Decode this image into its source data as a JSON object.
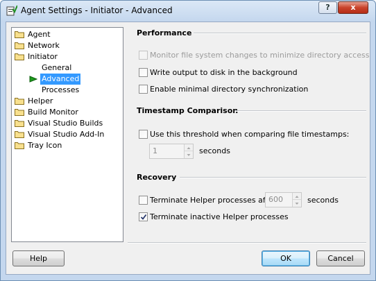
{
  "window": {
    "title": "Agent Settings - Initiator - Advanced",
    "help_glyph": "?",
    "close_glyph": "x"
  },
  "tree": {
    "items": [
      {
        "label": "Agent",
        "icon": "folder-icon"
      },
      {
        "label": "Network",
        "icon": "folder-icon"
      },
      {
        "label": "Initiator",
        "icon": "folder-icon"
      },
      {
        "label": "General"
      },
      {
        "label": "Advanced",
        "selected": true
      },
      {
        "label": "Processes"
      },
      {
        "label": "Helper",
        "icon": "folder-icon"
      },
      {
        "label": "Build Monitor",
        "icon": "folder-icon"
      },
      {
        "label": "Visual Studio Builds",
        "icon": "folder-icon"
      },
      {
        "label": "Visual Studio Add-In",
        "icon": "folder-icon"
      },
      {
        "label": "Tray Icon",
        "icon": "folder-icon"
      }
    ]
  },
  "performance": {
    "title": "Performance",
    "monitor_label": "Monitor file system changes to minimize directory access",
    "monitor_checked": false,
    "monitor_enabled": false,
    "write_label": "Write output to disk in the background",
    "write_checked": false,
    "sync_label": "Enable minimal directory synchronization",
    "sync_checked": false
  },
  "timestamp": {
    "title": "Timestamp Comparison",
    "threshold_label": "Use this threshold when comparing file timestamps:",
    "threshold_checked": false,
    "threshold_value": "1",
    "threshold_unit": "seconds"
  },
  "recovery": {
    "title": "Recovery",
    "terminate_after_label": "Terminate Helper processes after",
    "terminate_after_checked": false,
    "terminate_after_value": "600",
    "terminate_after_unit": "seconds",
    "terminate_inactive_label": "Terminate inactive Helper processes",
    "terminate_inactive_checked": true
  },
  "buttons": {
    "help": "Help",
    "ok": "OK",
    "cancel": "Cancel"
  },
  "colors": {
    "selection": "#3399ff",
    "accent_arrow": "#1e9b1e",
    "close_button": "#c9432b"
  }
}
